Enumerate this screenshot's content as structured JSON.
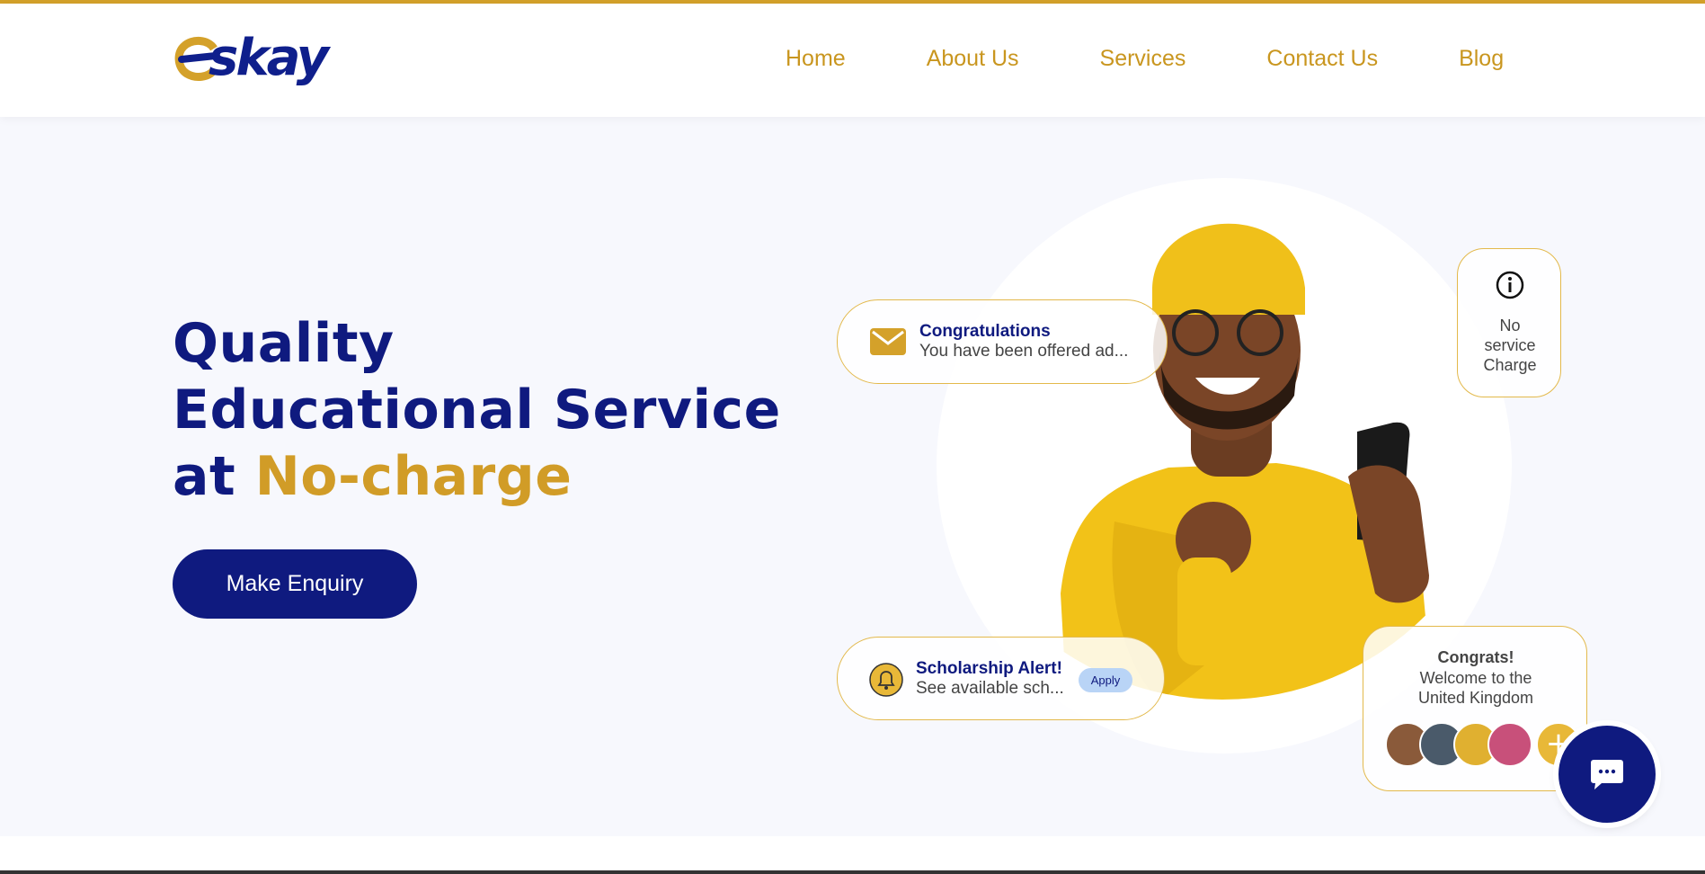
{
  "colors": {
    "brand_blue": "#0f1a7f",
    "brand_gold": "#d19c27",
    "hero_bg": "#f7f8fd"
  },
  "header": {
    "logo_text": "skay",
    "logo_lettering": "eskay",
    "nav": [
      "Home",
      "About Us",
      "Services",
      "Contact Us",
      "Blog"
    ]
  },
  "hero": {
    "headline_line1": "Quality",
    "headline_line2": "Educational Service",
    "headline_line3_prefix": "at ",
    "headline_line3_accent": "No-charge",
    "cta_label": "Make Enquiry"
  },
  "cards": {
    "offer": {
      "icon": "mail-icon",
      "title": "Congratulations",
      "text": "You have been offered ad..."
    },
    "scholarship": {
      "icon": "bell-icon",
      "title": "Scholarship Alert!",
      "text": "See available sch...",
      "button": "Apply"
    },
    "info": {
      "icon": "info-icon",
      "line1": "No",
      "line2": "service",
      "line3": "Charge"
    },
    "welcome": {
      "title": "Congrats!",
      "line1": "Welcome to the",
      "line2": "United Kingdom",
      "plus": "+"
    }
  },
  "chat": {
    "icon": "chat-bubble-icon"
  }
}
